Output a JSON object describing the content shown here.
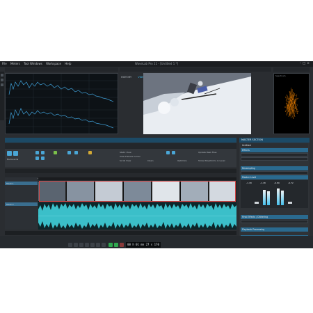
{
  "window": {
    "title": "WaveLab Pro 11 - [Untitled 1 *]",
    "menu": [
      "File",
      "Meters",
      "Tool Windows",
      "Workspace",
      "Help"
    ]
  },
  "top_tabs_left": [
    "PROJECT ANALYZER",
    "METADATA",
    "MARKERS",
    "CLIPS",
    "LEI",
    "SPECTROMETER"
  ],
  "top_tabs_mid": [
    "HISTORY",
    "VIDEO",
    "LEVEL METER",
    "LOUDNESS METER",
    "LIVE SPECTROGRAM",
    "WAVESCOPE"
  ],
  "top_tabs_right": [
    "PHASESCOPE"
  ],
  "scope_label": "Spectrum",
  "audio_editor": {
    "title": "AUDIO EDITOR",
    "ribbon": [
      "FILE",
      "VIEW",
      "EDIT",
      "INSERT",
      "PROCESS",
      "FADE",
      "ENVELOPE",
      "ANALYZE",
      "RENDER"
    ],
    "active_ribbon": "VIEW",
    "toolbar": {
      "backwards": "Backwards",
      "static_view": "Static View",
      "view_follows_cursor": "View Follows Cursor",
      "scroll_view": "Scroll View",
      "update_peak": "Update Peak Files",
      "show_waveform": "Show Waveforms in Level",
      "optimize": "Optimize",
      "clean": "Clean"
    },
    "file_group": "File Group 1",
    "doc_tab": "Untitled 1 *",
    "tracks": [
      "Track 1",
      "Track 2"
    ],
    "status": [
      "2 min 24 s 320 ms",
      "1 min 54 s 882 ms",
      "(x1.0)"
    ],
    "status_right": "Stereo 44 100 Hz"
  },
  "transport": {
    "timecode": "00 h 01 mn 27 s 170 ms"
  },
  "master_section": {
    "title": "MASTER SECTION",
    "preset": "Untitled",
    "sections": [
      "Effects",
      "Resampling",
      "Master Level",
      "Final Effects / Dithering",
      "Playback Processing",
      "Speaker Configuration"
    ],
    "level_values": [
      "-1.18",
      "-1.18",
      "-0.89",
      "-0.72"
    ],
    "render_label": "Render",
    "sample_rate": "44 100 Hz"
  },
  "colors": {
    "accent": "#3fb7e8",
    "waveform": "#3bbfc9",
    "play": "#2fa84f",
    "scope": "#ff8a00"
  }
}
